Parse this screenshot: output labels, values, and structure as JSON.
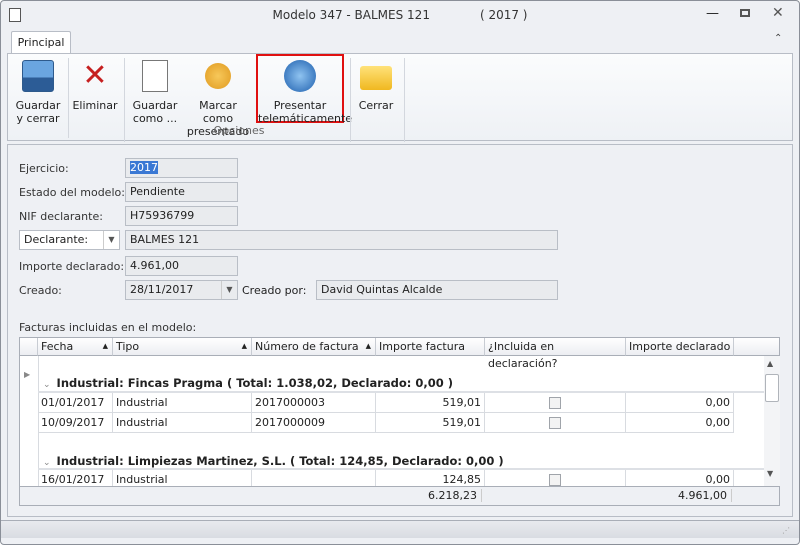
{
  "window": {
    "title": "Modelo 347 - BALMES 121",
    "year": "( 2017 )"
  },
  "ribbon": {
    "tab": "Principal",
    "group": "Opciones",
    "buttons": [
      {
        "l1": "Guardar",
        "l2": "y cerrar"
      },
      {
        "l1": "Eliminar",
        "l2": ""
      },
      {
        "l1": "Guardar",
        "l2": "como ..."
      },
      {
        "l1": "Marcar como",
        "l2": "presentado"
      },
      {
        "l1": "Presentar",
        "l2": "telemáticamente"
      },
      {
        "l1": "Cerrar",
        "l2": ""
      }
    ]
  },
  "form": {
    "ejercicio_label": "Ejercicio:",
    "ejercicio": "2017",
    "estado_label": "Estado del modelo:",
    "estado": "Pendiente",
    "nif_label": "NIF declarante:",
    "nif": "H75936799",
    "declarante_combo": "Declarante:",
    "declarante": "BALMES 121",
    "importe_label": "Importe declarado:",
    "importe": "4.961,00",
    "creado_label": "Creado:",
    "creado": "28/11/2017",
    "creado_por_label": "Creado por:",
    "creado_por": "David Quintas Alcalde"
  },
  "grid": {
    "title": "Facturas incluidas en el modelo:",
    "columns": [
      "Fecha",
      "Tipo",
      "Número de factura",
      "Importe factura",
      "¿Incluida en declaración?",
      "Importe declarado"
    ],
    "groups": [
      {
        "label": "Industrial: Fincas Pragma ( Total: 1.038,02, Declarado: 0,00 )",
        "rows": [
          [
            "01/01/2017",
            "Industrial",
            "2017000003",
            "519,01",
            false,
            "0,00"
          ],
          [
            "10/09/2017",
            "Industrial",
            "2017000009",
            "519,01",
            false,
            "0,00"
          ]
        ]
      },
      {
        "label": "Industrial: Limpiezas Martinez, S.L. ( Total: 124,85, Declarado: 0,00 )",
        "rows": [
          [
            "16/01/2017",
            "Industrial",
            "",
            "124,85",
            false,
            "0,00"
          ]
        ]
      }
    ],
    "total_importe": "6.218,23",
    "total_declarado": "4.961,00"
  }
}
